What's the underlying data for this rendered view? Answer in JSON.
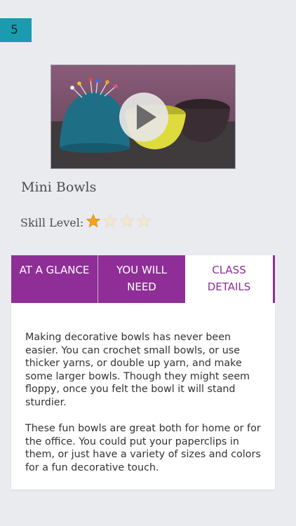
{
  "badge": {
    "number": "5"
  },
  "video": {
    "play_icon": "play-icon"
  },
  "class": {
    "title": "Mini Bowls"
  },
  "skill": {
    "label": "Skill Level:",
    "rating": 1,
    "max": 4,
    "filled_color": "#f2a21b",
    "empty_color": "#efe8d2"
  },
  "tabs": [
    {
      "label": "AT A GLANCE",
      "active": false
    },
    {
      "label": "YOU WILL NEED",
      "active": false
    },
    {
      "label": "CLASS DETAILS",
      "active": true
    }
  ],
  "details": {
    "paragraphs": [
      "Making decorative bowls has never been easier. You can crochet small bowls, or use thicker yarns, or double up yarn, and make some larger bowls. Though they might seem floppy, once you felt the bowl it will stand sturdier.",
      "These fun bowls are great both for home or for the office. You could put your paperclips in them, or just have a variety of sizes and colors for a fun decorative touch."
    ]
  },
  "colors": {
    "accent": "#8e2e96",
    "badge": "#1a9bb0",
    "background": "#e9ebee"
  }
}
